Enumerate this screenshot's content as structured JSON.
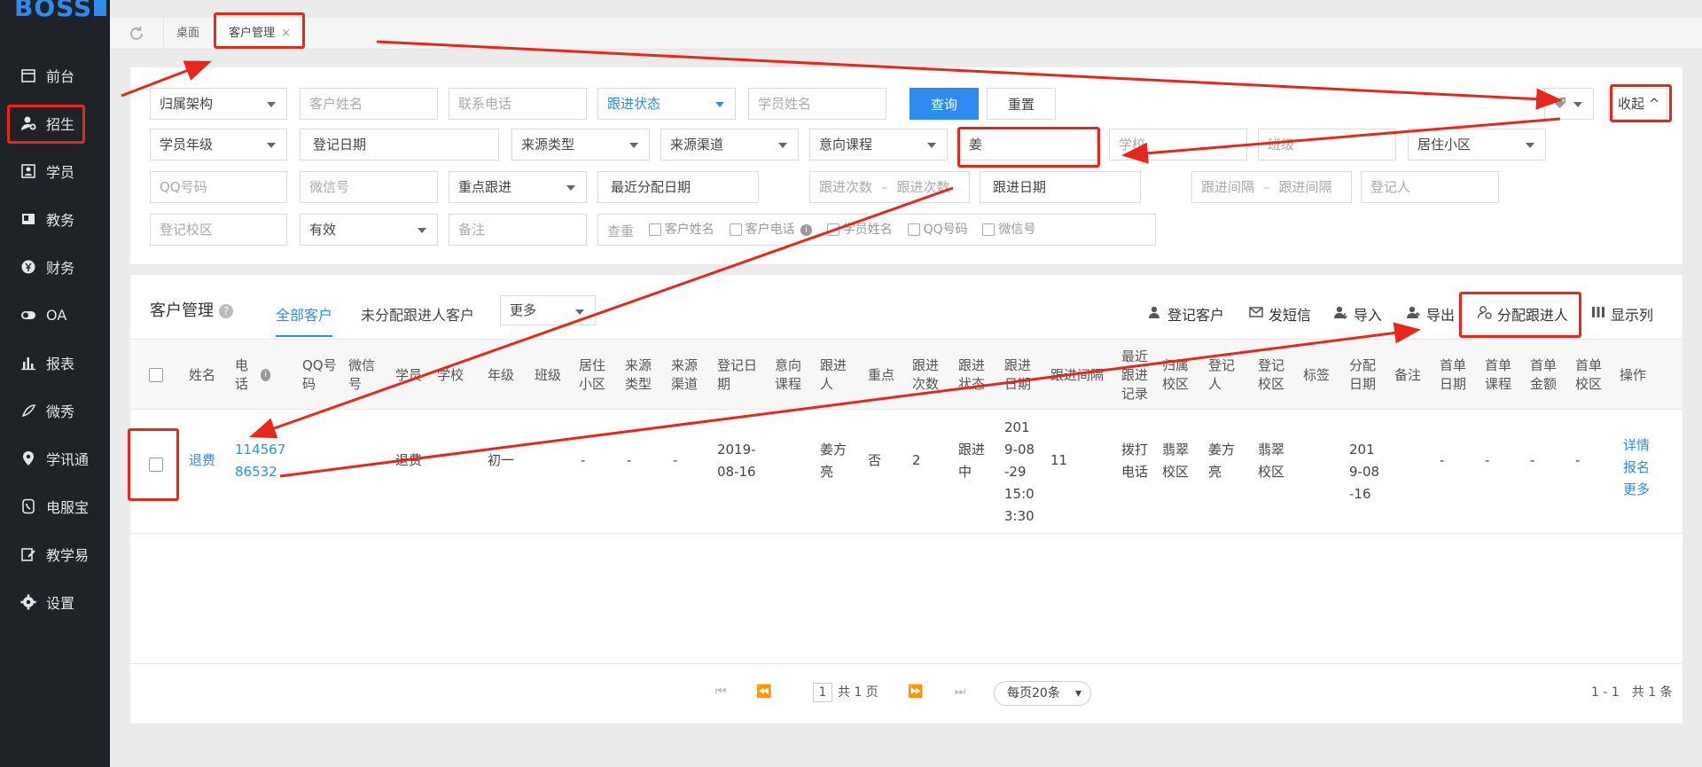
{
  "app": {
    "logo": "BOSS"
  },
  "sidebar": {
    "items": [
      {
        "label": "前台",
        "icon": "calendar-icon"
      },
      {
        "label": "招生",
        "icon": "user-add-icon"
      },
      {
        "label": "学员",
        "icon": "id-card-icon"
      },
      {
        "label": "教务",
        "icon": "book-icon"
      },
      {
        "label": "财务",
        "icon": "yen-icon"
      },
      {
        "label": "OA",
        "icon": "toggle-icon"
      },
      {
        "label": "报表",
        "icon": "bar-chart-icon"
      },
      {
        "label": "微秀",
        "icon": "feather-icon"
      },
      {
        "label": "学讯通",
        "icon": "location-icon"
      },
      {
        "label": "电服宝",
        "icon": "phone-icon"
      },
      {
        "label": "教学易",
        "icon": "edit-icon"
      },
      {
        "label": "设置",
        "icon": "gear-icon"
      }
    ]
  },
  "tabs": {
    "desk": "桌面",
    "customer": "客户管理",
    "close": "×"
  },
  "filters": {
    "org": "归属架构",
    "customer_name": "客户姓名",
    "phone": "联系电话",
    "follow_status": "跟进状态",
    "student_name": "学员姓名",
    "query": "查询",
    "reset": "重置",
    "collapse": "收起",
    "grade": "学员年级",
    "reg_date": "登记日期",
    "source_type": "来源类型",
    "source_channel": "来源渠道",
    "course": "意向课程",
    "keyword_value": "姜",
    "school": "学校",
    "class": "班级",
    "community": "居住小区",
    "qq": "QQ号码",
    "wechat": "微信号",
    "key_follow": "重点跟进",
    "last_assign_date": "最近分配日期",
    "follow_count_from": "跟进次数",
    "follow_count_sep": "–",
    "follow_count_to": "跟进次数",
    "follow_date": "跟进日期",
    "interval_from": "跟进间隔",
    "interval_sep": "–",
    "interval_to": "跟进间隔",
    "registrar": "登记人",
    "reg_campus": "登记校区",
    "valid": "有效",
    "remark": "备注",
    "dedupe": "查重",
    "dedupe_options": [
      "客户姓名",
      "客户电话",
      "学员姓名",
      "QQ号码",
      "微信号"
    ]
  },
  "main": {
    "title": "客户管理",
    "help": "?",
    "tab_all": "全部客户",
    "tab_unassigned": "未分配跟进人客户",
    "more": "更多",
    "actions": {
      "register": "登记客户",
      "sms": "发短信",
      "import": "导入",
      "export": "导出",
      "assign": "分配跟进人",
      "columns": "显示列"
    },
    "columns": [
      "姓名",
      "电话",
      "QQ号码",
      "微信号",
      "学员",
      "学校",
      "年级",
      "班级",
      "居住小区",
      "来源类型",
      "来源渠道",
      "登记日期",
      "意向课程",
      "跟进人",
      "重点",
      "跟进次数",
      "跟进状态",
      "跟进日期",
      "跟进间隔",
      "最近跟进记录",
      "归属校区",
      "登记人",
      "登记校区",
      "标签",
      "分配日期",
      "备注",
      "首单日期",
      "首单课程",
      "首单金额",
      "首单校区",
      "操作"
    ],
    "row": {
      "name": "退费",
      "phone": "11456786532",
      "student": "退费",
      "grade": "初一",
      "community": "-",
      "source_type": "-",
      "source_channel": "-",
      "reg_date": "2019-08-16",
      "follower": "姜方亮",
      "key": "否",
      "follow_count": "2",
      "follow_status": "跟进中",
      "follow_date": "2019-08-29 15:03:30",
      "interval": "11",
      "last_record": "拨打电话",
      "campus": "翡翠校区",
      "registrar": "姜方亮",
      "reg_campus": "翡翠校区",
      "assign_date": "2019-08-16",
      "first_date": "-",
      "first_course": "-",
      "first_amount": "-",
      "first_campus": "-",
      "op_detail": "详情",
      "op_enroll": "报名",
      "op_more": "更多"
    }
  },
  "pager": {
    "page": "1",
    "total_pages": "共 1 页",
    "per_page": "每页20条",
    "summary": "1 - 1　共 1 条"
  }
}
